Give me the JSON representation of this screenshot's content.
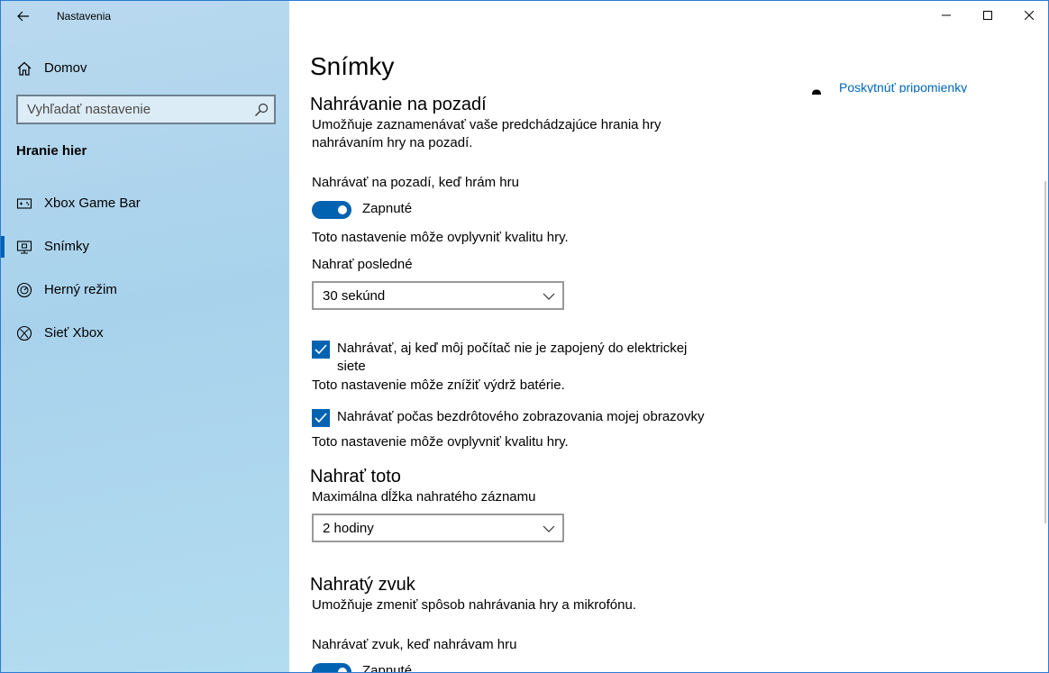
{
  "app": {
    "title": "Nastavenia"
  },
  "sidebar": {
    "home_label": "Domov",
    "search_placeholder": "Vyhľadať nastavenie",
    "section_title": "Hranie hier",
    "items": [
      {
        "label": "Xbox Game Bar",
        "icon": "game-bar-icon",
        "selected": false
      },
      {
        "label": "Snímky",
        "icon": "captures-icon",
        "selected": true
      },
      {
        "label": "Herný režim",
        "icon": "game-mode-icon",
        "selected": false
      },
      {
        "label": "Sieť Xbox",
        "icon": "xbox-icon",
        "selected": false
      }
    ]
  },
  "main": {
    "page_title": "Snímky",
    "feedback_link": "Poskytnúť pripomienky",
    "background_recording": {
      "heading": "Nahrávanie na pozadí",
      "description_line1": "Umožňuje zaznamenávať vaše predchádzajúce hrania hry",
      "description_line2": "nahrávaním hry na pozadí.",
      "toggle_title": "Nahrávať na pozadí, keď hrám hru",
      "toggle_state": "Zapnuté",
      "toggle_note": "Toto nastavenie môže ovplyvniť kvalitu hry.",
      "record_last_label": "Nahrať posledné",
      "record_last_value": "30 sekúnd",
      "battery_checkbox_line1": "Nahrávať, aj keď môj počítač nie je zapojený do elektrickej",
      "battery_checkbox_line2": "siete",
      "battery_note": "Toto nastavenie môže znížiť výdrž batérie.",
      "wireless_checkbox": "Nahrávať počas bezdrôtového zobrazovania mojej obrazovky",
      "wireless_note": "Toto nastavenie môže ovplyvniť kvalitu hry."
    },
    "record_this": {
      "heading": "Nahrať toto",
      "max_length_label": "Maximálna dĺžka nahratého záznamu",
      "max_length_value": "2 hodiny"
    },
    "recorded_audio": {
      "heading": "Nahratý zvuk",
      "description": "Umožňuje zmeniť spôsob nahrávania hry a mikrofónu.",
      "toggle_title": "Nahrávať zvuk, keď nahrávam hru",
      "toggle_state": "Zapnuté"
    }
  },
  "colors": {
    "accent": "#0063b1",
    "link": "#0067b8",
    "sidebar_bg": "#a8d2ec"
  }
}
